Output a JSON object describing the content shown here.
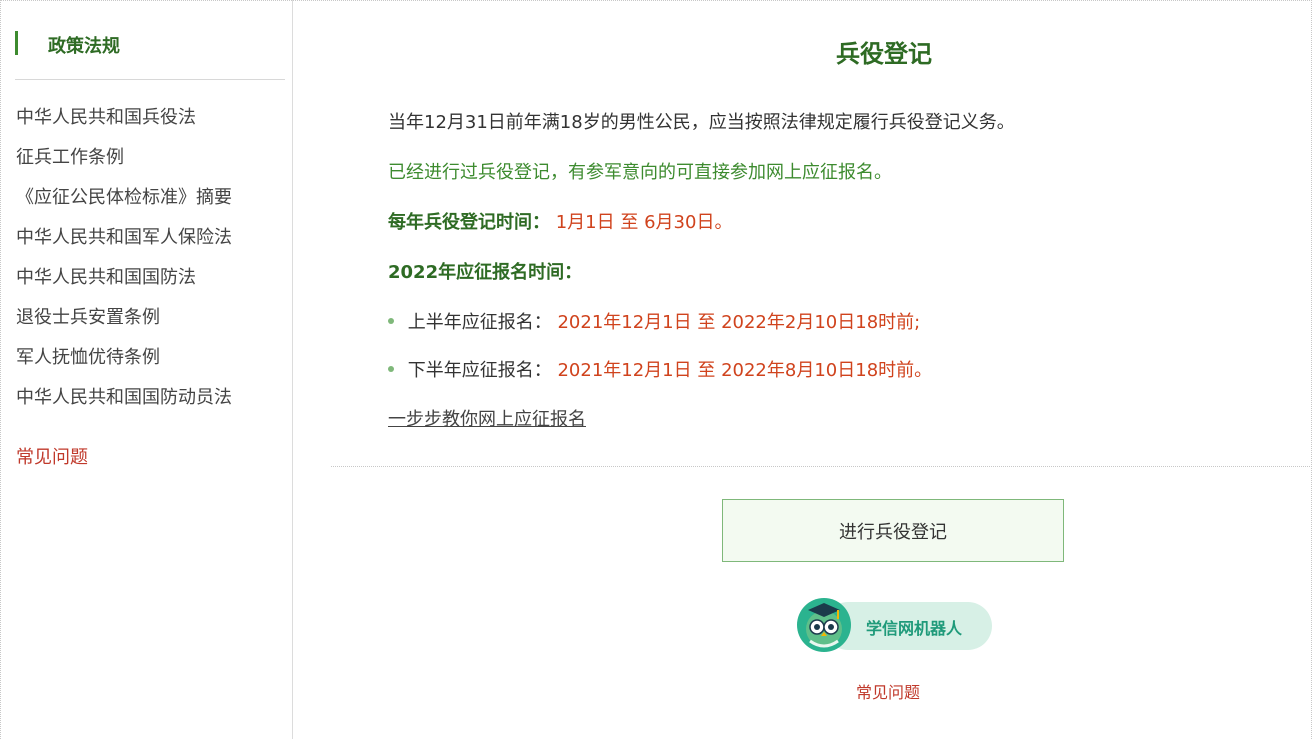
{
  "sidebar": {
    "title": "政策法规",
    "items": [
      {
        "label": "中华人民共和国兵役法"
      },
      {
        "label": "征兵工作条例"
      },
      {
        "label": "《应征公民体检标准》摘要"
      },
      {
        "label": "中华人民共和国军人保险法"
      },
      {
        "label": "中华人民共和国国防法"
      },
      {
        "label": "退役士兵安置条例"
      },
      {
        "label": "军人抚恤优待条例"
      },
      {
        "label": "中华人民共和国国防动员法"
      }
    ],
    "faq": "常见问题"
  },
  "main": {
    "title": "兵役登记",
    "line1": "当年12月31日前年满18岁的男性公民，应当按照法律规定履行兵役登记义务。",
    "line2": "已经进行过兵役登记，有参军意向的可直接参加网上应征报名。",
    "registration_time_label": "每年兵役登记时间：",
    "registration_time_value": "1月1日 至 6月30日。",
    "apply_time_label": "2022年应征报名时间：",
    "first_half_label": "上半年应征报名：",
    "first_half_value": "2021年12月1日 至 2022年2月10日18时前;",
    "second_half_label": "下半年应征报名：",
    "second_half_value": "2021年12月1日 至 2022年8月10日18时前。",
    "guide_link": "一步步教你网上应征报名",
    "register_button": "进行兵役登记",
    "robot_label": "学信网机器人",
    "faq": "常见问题"
  },
  "colors": {
    "accent_green": "#2e6b24",
    "highlight_red": "#d0431d",
    "robot_teal": "#1f9a7a"
  }
}
